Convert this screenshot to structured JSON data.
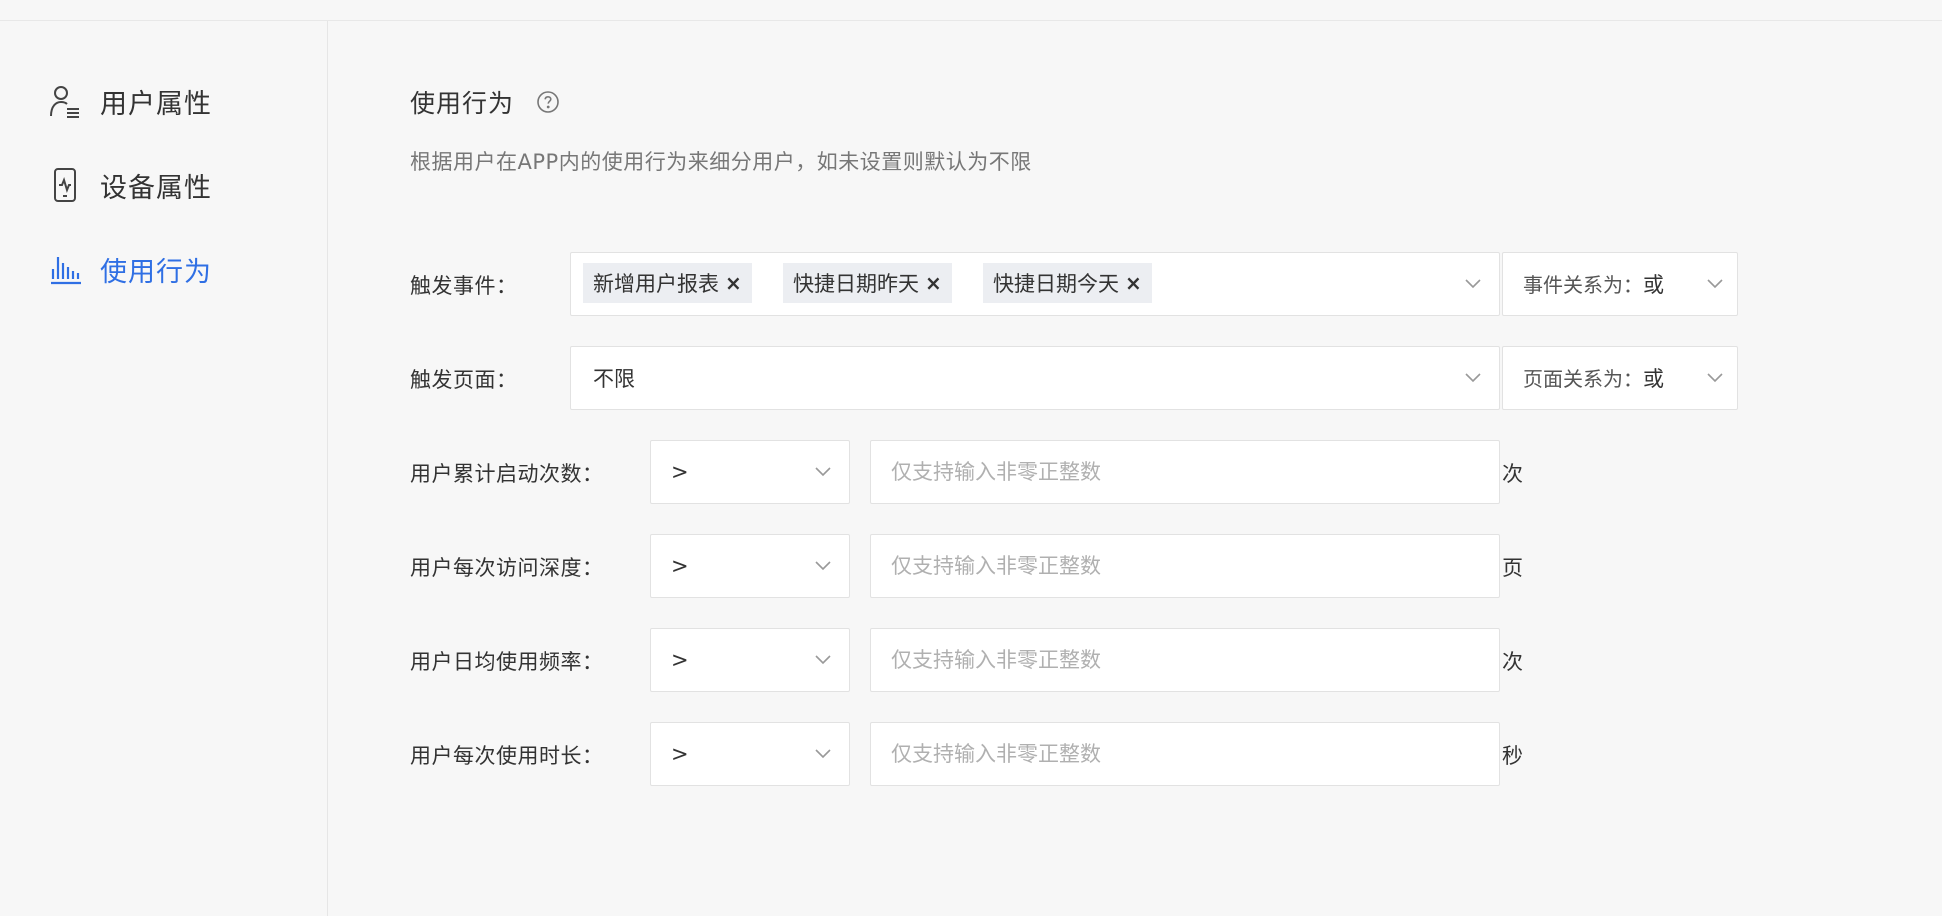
{
  "sidebar": {
    "items": [
      {
        "label": "用户属性",
        "icon": "user-profile-icon"
      },
      {
        "label": "设备属性",
        "icon": "mobile-device-icon"
      },
      {
        "label": "使用行为",
        "icon": "bar-chart-icon",
        "active": true
      }
    ]
  },
  "section": {
    "title": "使用行为",
    "description": "根据用户在APP内的使用行为来细分用户，如未设置则默认为不限"
  },
  "trigger_event": {
    "label": "触发事件：",
    "tags": [
      "新增用户报表",
      "快捷日期昨天",
      "快捷日期今天"
    ],
    "relation_label": "事件关系为：",
    "relation_value": "或"
  },
  "trigger_page": {
    "label": "触发页面：",
    "value": "不限",
    "relation_label": "页面关系为：",
    "relation_value": "或"
  },
  "metrics": [
    {
      "label": "用户累计启动次数：",
      "operator": ">",
      "placeholder": "仅支持输入非零正整数",
      "unit": "次"
    },
    {
      "label": "用户每次访问深度：",
      "operator": ">",
      "placeholder": "仅支持输入非零正整数",
      "unit": "页"
    },
    {
      "label": "用户日均使用频率：",
      "operator": ">",
      "placeholder": "仅支持输入非零正整数",
      "unit": "次"
    },
    {
      "label": "用户每次使用时长：",
      "operator": ">",
      "placeholder": "仅支持输入非零正整数",
      "unit": "秒"
    }
  ],
  "colors": {
    "accent": "#2f6fe4",
    "background": "#f7f7f7",
    "border": "#e2e2e2"
  }
}
